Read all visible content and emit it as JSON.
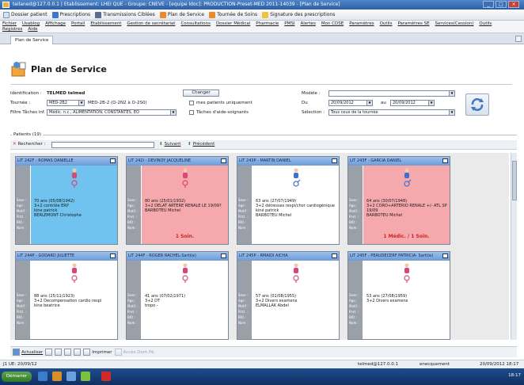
{
  "window": {
    "title": "teilaned@127.0.0.1 | Etablissement: LHEI QUE - Groupe: CNEVE - [equipe ldoc]: PRODUCTION-Preset-MED 2011-14039 - [Plan de Service]"
  },
  "toolbar": {
    "items": [
      "Dossier patient",
      "Prescriptions",
      "Transmissions Ciblées",
      "Plan de Service",
      "Tournée de Soins",
      "Signature des prescriptions"
    ]
  },
  "menu": {
    "items": [
      "Fichier",
      "Usablog",
      "Affichage",
      "Portail",
      "Etablissement",
      "Gestion de secrétariat",
      "Consultations",
      "Dossier Médical",
      "Pharmacie",
      "PMSI",
      "Alertes",
      "Mon CDSE",
      "Paramètres",
      "Outils",
      "Paramètres SE",
      "Services(Cession)",
      "Outils",
      "Registres",
      "Aide"
    ]
  },
  "tabs": {
    "active": "Plan de Service"
  },
  "page": {
    "title": "Plan de Service"
  },
  "filters": {
    "ident_label": "Identification :",
    "ident_value": "TELMED telmed",
    "change_label": "Changer",
    "tournee_label": "Tournée :",
    "tournee_value": "MED-2B2",
    "tournee_extra": "MED-2B-2 (O-2N2 à O-2S0)",
    "filtre_label": "Filtre Tâches inf. :",
    "filtre_value": "Médic. n.c., ALIMENTATION, CONSTANTES, EO",
    "mes_patients": "mes patients uniquement",
    "taches_aide": "Tâches d'aide-soignants",
    "modele_label": "Modèle :",
    "modele_value": "",
    "du_label": "Du",
    "du_value": "20/09/2012",
    "au_label": "au",
    "au_value": "20/09/2012",
    "selection_label": "Sélection :",
    "selection_value": "Tous ceux de la tournée"
  },
  "patients": {
    "title": "Patients (19)",
    "search_label": "Rechercher :",
    "next_label": "Suivant",
    "prev_label": "Précédent",
    "side_labels": [
      "Sexe :",
      "Age :",
      "Motif :",
      "Prat. :",
      "BIO :",
      "Nom :"
    ],
    "cards": [
      {
        "header": "LIT 242F - ROMAS DANIELLE",
        "gender": "female",
        "bg": "#6fc3ee",
        "age": "70 ans (05/08/1942)",
        "motif": "3+2 contrôle ERP",
        "kine": "kine patrick",
        "prat": "BERLEMONT Christophe",
        "soins": ""
      },
      {
        "header": "LIT 242I - DEVINOY JACQUELINE",
        "gender": "female",
        "bg": "#f5a9ad",
        "age": "80 ans (25/01/1932)",
        "motif": "3+2 DELAT ARTERE RENALE LE 19/09?",
        "kine": "",
        "prat": "BARBOTEU Michel",
        "soins": "1 Soin."
      },
      {
        "header": "LIT 243P - MARTIN DANIEL",
        "gender": "male",
        "bg": "#ffffff",
        "age": "63 ans (27/07/1949)",
        "motif": "3+2 détresses respi/chor cardiogénique",
        "kine": "kiné patrick",
        "prat": "BARBOTEU Michel",
        "soins": ""
      },
      {
        "header": "LIT 243F - GARCIA DANIEL",
        "gender": "male",
        "bg": "#f5a9ad",
        "age": "64 ans (30/07/1948)",
        "motif": "3+2 CORO+ARTERIO RENALE +/- ATL SP 19/09",
        "kine": "",
        "prat": "BARBOTEU Michel",
        "soins": "1 Médic. / 1 Soin."
      },
      {
        "header": "LIT 244P - GODARD JULIETTE",
        "gender": "female",
        "bg": "#ffffff",
        "age": "88 ans (25/11/1923)",
        "motif": "3+2 Decompensation cardio respi",
        "kine": "kine beatrice",
        "prat": "",
        "soins": ""
      },
      {
        "header": "LIT 244F - ROGER RACHEL-Sarti(e)",
        "gender": "female",
        "bg": "#ffffff",
        "age": "41 ans (07/02/1971)",
        "motif": "3+2 DT",
        "kine": "",
        "prat": "tropo -",
        "soins": ""
      },
      {
        "header": "LIT 245P - RMAIDI AICHA",
        "gender": "female",
        "bg": "#ffffff",
        "age": "57 ans (01/08/1955)",
        "motif": "3+2 Divers examens",
        "kine": "",
        "prat": "ELMALLAK Abdel",
        "soins": ""
      },
      {
        "header": "LIT 245F - PEAUDECERF PATRICIA- Sarti(e)",
        "gender": "female",
        "bg": "#ffffff",
        "age": "53 ans (27/08/1959)",
        "motif": "3+2 Divers examens",
        "kine": "",
        "prat": "",
        "soins": ""
      }
    ]
  },
  "bottom": {
    "refresh_label": "Actualiser",
    "print_label": "Imprimer",
    "access_label": "Accès Dom Pé"
  },
  "status": {
    "date_left": "J1 UE: 20/09/12",
    "user": "telmed@127.0.0.1",
    "mode": "enecquement",
    "datetime": "20/09/2012  18:17"
  },
  "taskbar": {
    "start": "Démarrer",
    "clock": "18:17"
  }
}
